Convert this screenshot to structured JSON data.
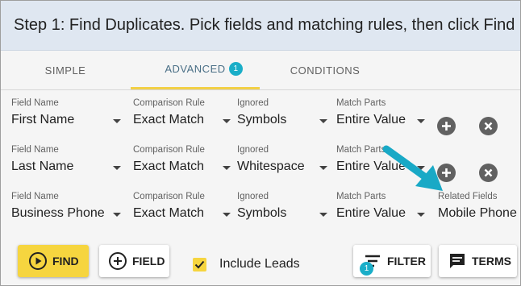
{
  "header": {
    "title": "Step 1: Find Duplicates. Pick fields and matching rules, then click Find"
  },
  "tabs": [
    {
      "label": "SIMPLE"
    },
    {
      "label": "ADVANCED",
      "badge": "1"
    },
    {
      "label": "CONDITIONS"
    }
  ],
  "labels": {
    "field_name": "Field Name",
    "comparison_rule": "Comparison Rule",
    "ignored": "Ignored",
    "match_parts": "Match Parts",
    "related_fields": "Related Fields"
  },
  "rows": [
    {
      "field": "First Name",
      "rule": "Exact Match",
      "ignored": "Symbols",
      "match_parts": "Entire Value"
    },
    {
      "field": "Last Name",
      "rule": "Exact Match",
      "ignored": "Whitespace",
      "match_parts": "Entire Value"
    },
    {
      "field": "Business Phone",
      "rule": "Exact Match",
      "ignored": "Symbols",
      "match_parts": "Entire Value",
      "related_fields": "Mobile Phone"
    }
  ],
  "footer": {
    "find_label": "FIND",
    "field_label": "FIELD",
    "include_leads_label": "Include Leads",
    "include_leads_checked": true,
    "filter_label": "FILTER",
    "filter_badge": "1",
    "terms_label": "TERMS"
  },
  "colors": {
    "accent_yellow": "#f6d53f",
    "badge_teal": "#1aaec8",
    "arrow_teal": "#19a9c6",
    "header_bg": "#dfe7f1"
  },
  "icons": [
    "plus-circle-icon",
    "close-circle-icon",
    "play-circle-icon",
    "add-circle-outline-icon",
    "check-icon",
    "filter-icon",
    "message-icon",
    "arrow-pointer"
  ]
}
